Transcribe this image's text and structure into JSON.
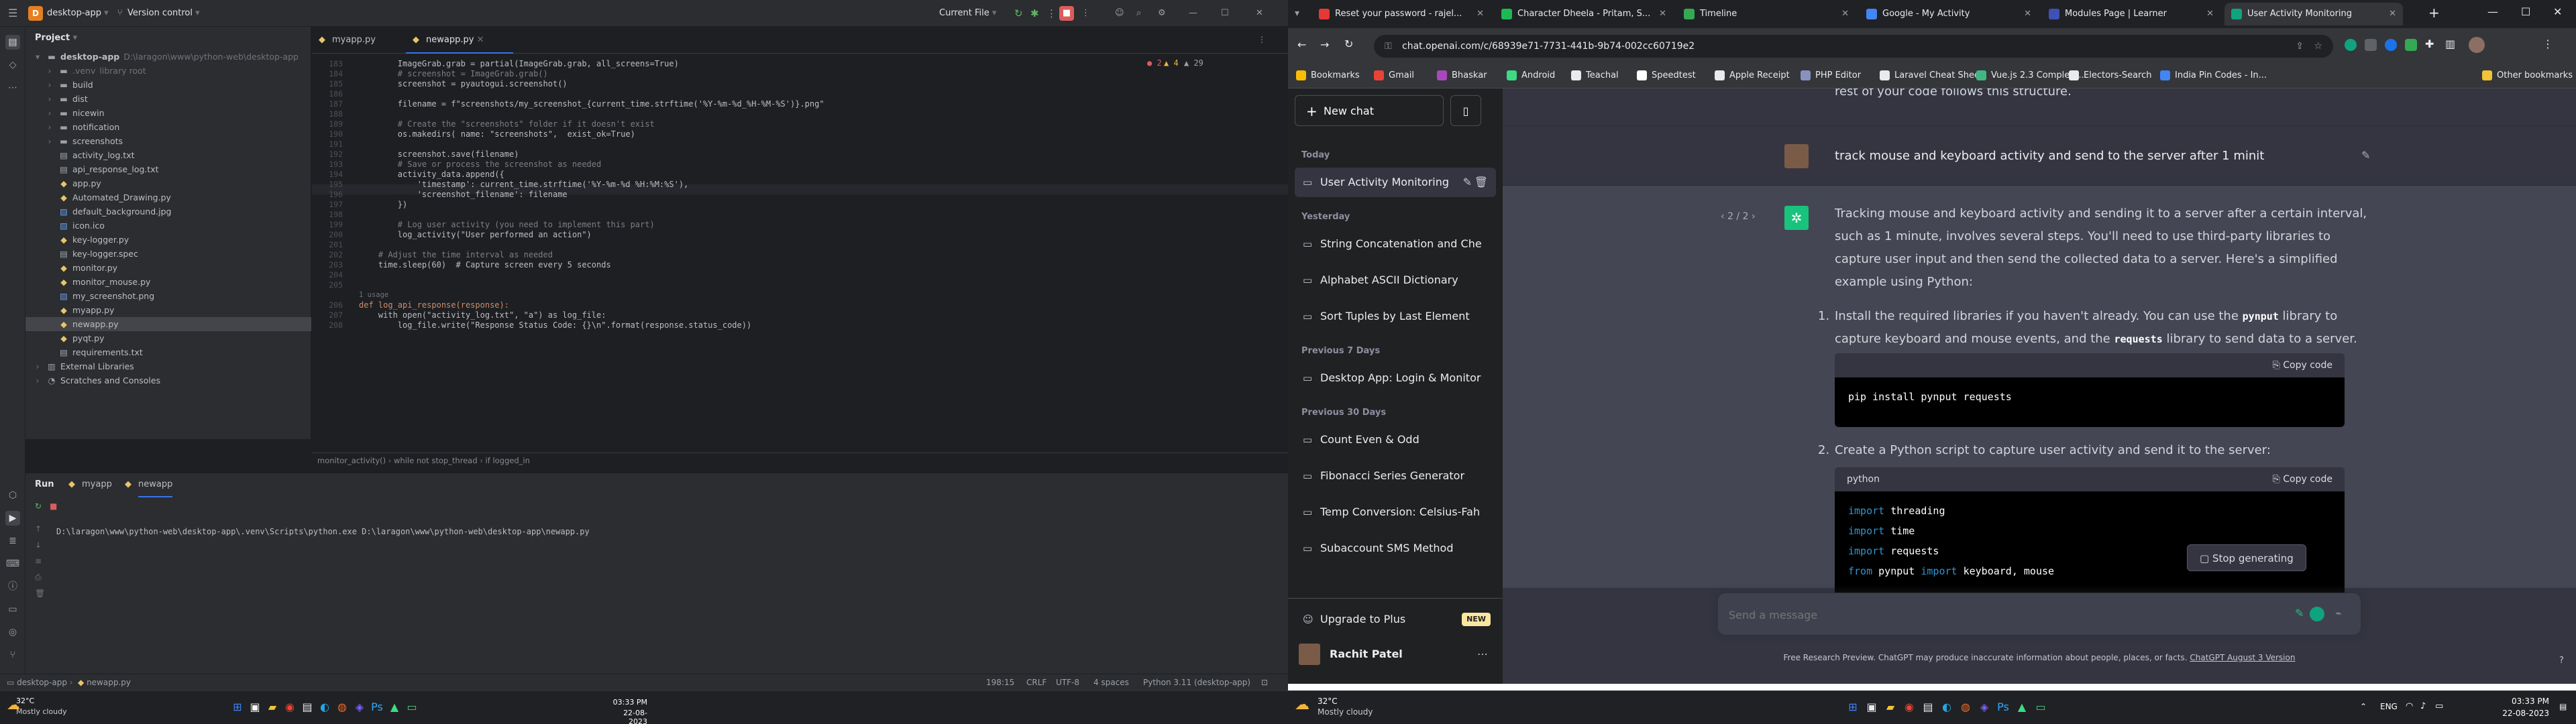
{
  "pycharm": {
    "project_name": "desktop-app",
    "project_badge": "D",
    "vcs": "Version control",
    "run_config": "Current File",
    "panel_title": "Project",
    "tree": [
      {
        "label": "desktop-app",
        "extra": "D:\\laragon\\www\\python-web\\desktop-app",
        "icon": "folder-icon",
        "depth": 0,
        "exp": true
      },
      {
        "label": ".venv",
        "extra": "library root",
        "icon": "folder-icon",
        "depth": 1,
        "dim": true
      },
      {
        "label": "build",
        "icon": "folder-icon",
        "depth": 1
      },
      {
        "label": "dist",
        "icon": "folder-icon",
        "depth": 1
      },
      {
        "label": "nicewin",
        "icon": "folder-icon",
        "depth": 1
      },
      {
        "label": "notification",
        "icon": "folder-icon",
        "depth": 1
      },
      {
        "label": "screenshots",
        "icon": "folder-icon",
        "depth": 1
      },
      {
        "label": "activity_log.txt",
        "icon": "text-file-icon",
        "depth": 1
      },
      {
        "label": "api_response_log.txt",
        "icon": "text-file-icon",
        "depth": 1
      },
      {
        "label": "app.py",
        "icon": "python-file-icon",
        "depth": 1
      },
      {
        "label": "Automated_Drawing.py",
        "icon": "python-file-icon",
        "depth": 1
      },
      {
        "label": "default_background.jpg",
        "icon": "image-file-icon",
        "depth": 1
      },
      {
        "label": "icon.ico",
        "icon": "image-file-icon",
        "depth": 1
      },
      {
        "label": "key-logger.py",
        "icon": "python-file-icon",
        "depth": 1
      },
      {
        "label": "key-logger.spec",
        "icon": "text-file-icon",
        "depth": 1
      },
      {
        "label": "monitor.py",
        "icon": "python-file-icon",
        "depth": 1
      },
      {
        "label": "monitor_mouse.py",
        "icon": "python-file-icon",
        "depth": 1
      },
      {
        "label": "my_screenshot.png",
        "icon": "image-file-icon",
        "depth": 1
      },
      {
        "label": "myapp.py",
        "icon": "python-file-icon",
        "depth": 1
      },
      {
        "label": "newapp.py",
        "icon": "python-file-icon",
        "depth": 1,
        "sel": true
      },
      {
        "label": "pyqt.py",
        "icon": "python-file-icon",
        "depth": 1
      },
      {
        "label": "requirements.txt",
        "icon": "text-file-icon",
        "depth": 1
      },
      {
        "label": "External Libraries",
        "icon": "library-icon",
        "depth": 0
      },
      {
        "label": "Scratches and Consoles",
        "icon": "scratch-icon",
        "depth": 0
      }
    ],
    "tabs": [
      {
        "label": "myapp.py",
        "active": false
      },
      {
        "label": "newapp.py",
        "active": true
      }
    ],
    "inspections": {
      "errors": "2",
      "warnings": "4",
      "weak": "29"
    },
    "lines": [
      {
        "n": "183",
        "code": "        ImageGrab.grab = partial(ImageGrab.grab, all_screens=True)"
      },
      {
        "n": "184",
        "code": "        # screenshot = ImageGrab.grab()"
      },
      {
        "n": "185",
        "code": "        screenshot = pyautogui.screenshot()"
      },
      {
        "n": "186",
        "code": ""
      },
      {
        "n": "187",
        "code": "        filename = f\"screenshots/my_screenshot_{current_time.strftime('%Y-%m-%d_%H-%M-%S')}.png\""
      },
      {
        "n": "188",
        "code": ""
      },
      {
        "n": "189",
        "code": "        # Create the \"screenshots\" folder if it doesn't exist"
      },
      {
        "n": "190",
        "code": "        os.makedirs( name: \"screenshots\",  exist_ok=True)"
      },
      {
        "n": "191",
        "code": ""
      },
      {
        "n": "192",
        "code": "        screenshot.save(filename)"
      },
      {
        "n": "193",
        "code": "        # Save or process the screenshot as needed"
      },
      {
        "n": "194",
        "code": "        activity_data.append({"
      },
      {
        "n": "195",
        "code": "            'timestamp': current_time.strftime('%Y-%m-%d %H:%M:%S'),"
      },
      {
        "n": "196",
        "code": "            'screenshot_filename': filename"
      },
      {
        "n": "197",
        "code": "        })"
      },
      {
        "n": "198",
        "code": ""
      },
      {
        "n": "199",
        "code": "        # Log user activity (you need to implement this part)"
      },
      {
        "n": "200",
        "code": "        log_activity(\"User performed an action\")"
      },
      {
        "n": "201",
        "code": ""
      },
      {
        "n": "202",
        "code": "    # Adjust the time interval as needed"
      },
      {
        "n": "203",
        "code": "    time.sleep(60)  # Capture screen every 5 seconds"
      },
      {
        "n": "204",
        "code": ""
      },
      {
        "n": "205",
        "code": ""
      },
      {
        "n": "",
        "code": "1 usage"
      },
      {
        "n": "206",
        "code": "def log_api_response(response):"
      },
      {
        "n": "207",
        "code": "    with open(\"activity_log.txt\", \"a\") as log_file:"
      },
      {
        "n": "208",
        "code": "        log_file.write(\"Response Status Code: {}\\n\".format(response.status_code))"
      }
    ],
    "breadcrumb": [
      "monitor_activity()",
      "while not stop_thread",
      "if logged_in"
    ],
    "run_label": "Run",
    "run_tabs": [
      "myapp",
      "newapp"
    ],
    "console_line": "D:\\laragon\\www\\python-web\\desktop-app\\.venv\\Scripts\\python.exe D:\\laragon\\www\\python-web\\desktop-app\\newapp.py",
    "status_path": [
      "desktop-app",
      "newapp.py"
    ],
    "status_right": [
      "198:15",
      "CRLF",
      "UTF-8",
      "4 spaces",
      "Python 3.11 (desktop-app)"
    ]
  },
  "left_taskbar": {
    "weather_temp": "32°C",
    "weather_text": "Mostly cloudy",
    "time": "03:33 PM",
    "date": "22-08-2023"
  },
  "chrome": {
    "tabs": [
      {
        "label": "Reset your password - rajel...",
        "color": "#e53935"
      },
      {
        "label": "Character Dheela - Pritam, S...",
        "color": "#1db954"
      },
      {
        "label": "Timeline",
        "color": "#34a853"
      },
      {
        "label": "Google - My Activity",
        "color": "#4285f4"
      },
      {
        "label": "Modules Page | Learner",
        "color": "#3f51b5"
      },
      {
        "label": "User Activity Monitoring",
        "color": "#10a37f",
        "active": true
      }
    ],
    "url": "chat.openai.com/c/68939e71-7731-441b-9b74-002cc60719e2",
    "bookmarks": [
      "Bookmarks",
      "Gmail",
      "Bhaskar",
      "Android",
      "Teachal",
      "Speedtest",
      "Apple Receipt",
      "PHP Editor",
      "Laravel Cheat Sheet",
      "Vue.js 2.3 Complete...",
      "Electors-Search",
      "India Pin Codes - In..."
    ],
    "other_bookmarks": "Other bookmarks"
  },
  "chatgpt": {
    "new_chat": "New chat",
    "groups": [
      {
        "label": "Today",
        "items": [
          "User Activity Monitoring"
        ]
      },
      {
        "label": "Yesterday",
        "items": [
          "String Concatenation and Che",
          "Alphabet ASCII Dictionary",
          "Sort Tuples by Last Element"
        ]
      },
      {
        "label": "Previous 7 Days",
        "items": [
          "Desktop App: Login & Monitor"
        ]
      },
      {
        "label": "Previous 30 Days",
        "items": [
          "Count Even & Odd",
          "Fibonacci Series Generator",
          "Temp Conversion: Celsius-Fah",
          "Subaccount SMS Method"
        ]
      }
    ],
    "upgrade": "Upgrade to Plus",
    "new_badge": "NEW",
    "user": "Rachit Patel",
    "top_text": "rest of your code follows this structure.",
    "user_message": "track mouse and keyboard activity and send to the server after 1 minit",
    "pager": "2 / 2",
    "answer_intro": "Tracking mouse and keyboard activity and sending it to a server after a certain interval, such as 1 minute, involves several steps. You'll need to use third-party libraries to capture user input and then send the collected data to a server. Here's a simplified example using Python:",
    "step1_pre": "Install the required libraries if you haven't already. You can use the ",
    "step1_lib1": "pynput",
    "step1_mid": " library to capture keyboard and mouse events, and the ",
    "step1_lib2": "requests",
    "step1_post": " library to send data to a server.",
    "copy_label": "Copy code",
    "cmd": "pip install pynput requests",
    "step2": "Create a Python script to capture user activity and send it to the server:",
    "lang": "python",
    "code": [
      {
        "kw": "import",
        "rest": " threading"
      },
      {
        "kw": "import",
        "rest": " time"
      },
      {
        "kw": "import",
        "rest": " requests"
      },
      {
        "kw": "from",
        "rest": " pynput ",
        "kw2": "import",
        "rest2": " keyboard, mouse"
      }
    ],
    "stop": "Stop generating",
    "placeholder": "Send a message",
    "footer": "Free Research Preview. ChatGPT may produce inaccurate information about people, places, or facts.",
    "footer_link": "ChatGPT August 3 Version"
  },
  "right_taskbar": {
    "weather_temp": "32°C",
    "weather_text": "Mostly cloudy",
    "lang": "ENG",
    "time": "03:33 PM",
    "date": "22-08-2023"
  }
}
